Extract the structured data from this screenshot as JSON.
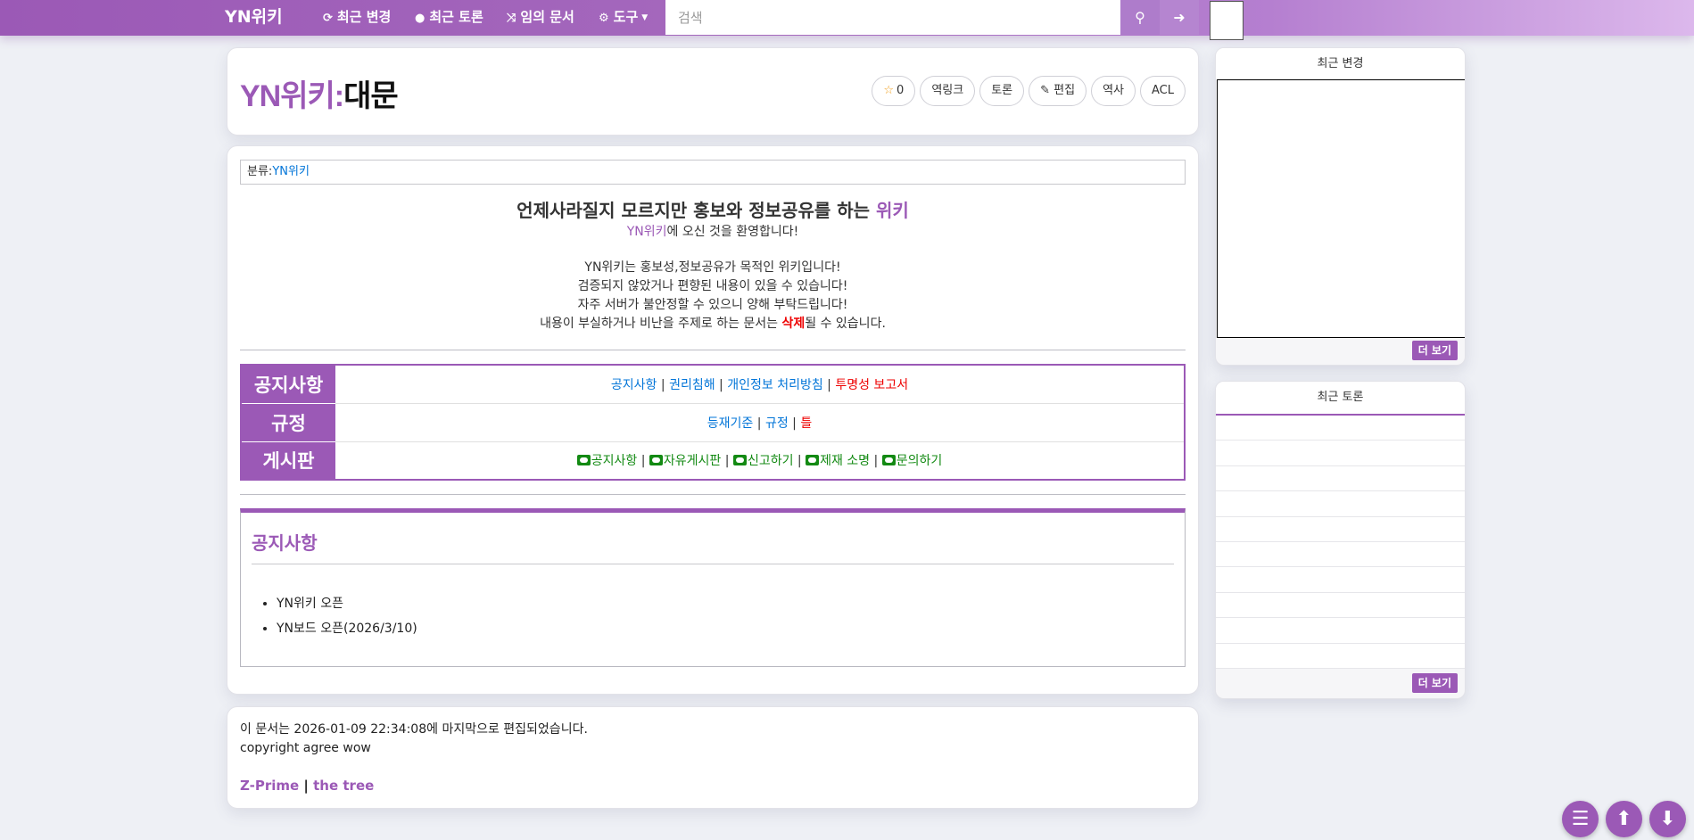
{
  "navbar": {
    "brand": "YN위키",
    "items": [
      {
        "label": "최근 변경",
        "icon": "refresh-icon"
      },
      {
        "label": "최근 토론",
        "icon": "comments-icon"
      },
      {
        "label": "임의 문서",
        "icon": "random-icon"
      },
      {
        "label": "도구",
        "icon": "gear-icon"
      }
    ],
    "search_placeholder": "검색"
  },
  "document": {
    "namespace": "YN위키:",
    "name": "대문",
    "star_count": "0",
    "actions": [
      "역링크",
      "토론",
      "편집",
      "역사",
      "ACL"
    ]
  },
  "category": {
    "label": "분류:",
    "value": "YN위키"
  },
  "intro": {
    "headline": "언제사라질지 모르지만 홍보와 정보공유를 하는 ",
    "headline_accent": "위키",
    "welcome_link": "YN위키",
    "welcome_rest": "에 오신 것을 환영합니다!",
    "line1": "YN위키는 홍보성,정보공유가 목적인 위키입니다!",
    "line2": "검증되지 않았거나 편향된 내용이 있을 수 있습니다!",
    "line3": "자주 서버가 불안정할 수 있으니 양해 부탁드립니다!",
    "line4_pre": "내용이 부실하거나 비난을 주제로 하는 문서는 ",
    "line4_del": "삭제",
    "line4_post": "될 수 있습니다."
  },
  "nav_table": {
    "rows": [
      {
        "header": "공지사항",
        "links": [
          "공지사항",
          "권리침해",
          "개인정보 처리방침",
          "투명성 보고서"
        ]
      },
      {
        "header": "규정",
        "links": [
          "등재기준",
          "규정",
          "틀"
        ]
      },
      {
        "header": "게시판",
        "links": [
          "공지사항",
          "자유게시판",
          "신고하기",
          "제재 소명",
          "문의하기"
        ]
      }
    ],
    "separator": "|"
  },
  "notice": {
    "title": "공지사항",
    "items": [
      "YN위키 오픈",
      "YN보드 오픈(2026/3/10)"
    ]
  },
  "footer": {
    "edited": "이 문서는 2026-01-09 22:34:08에 마지막으로 편집되었습니다.",
    "copyright": "copyright agree wow",
    "link1": "Z-Prime",
    "sep": "|",
    "link2": "the tree"
  },
  "sidebar": {
    "recent_changes_title": "최근 변경",
    "recent_discuss_title": "최근 토론",
    "more_label": "더 보기"
  },
  "colors": {
    "accent": "#9b59b6",
    "link": "#0275d8",
    "danger": "#ee0000",
    "board_green": "#138a13"
  }
}
